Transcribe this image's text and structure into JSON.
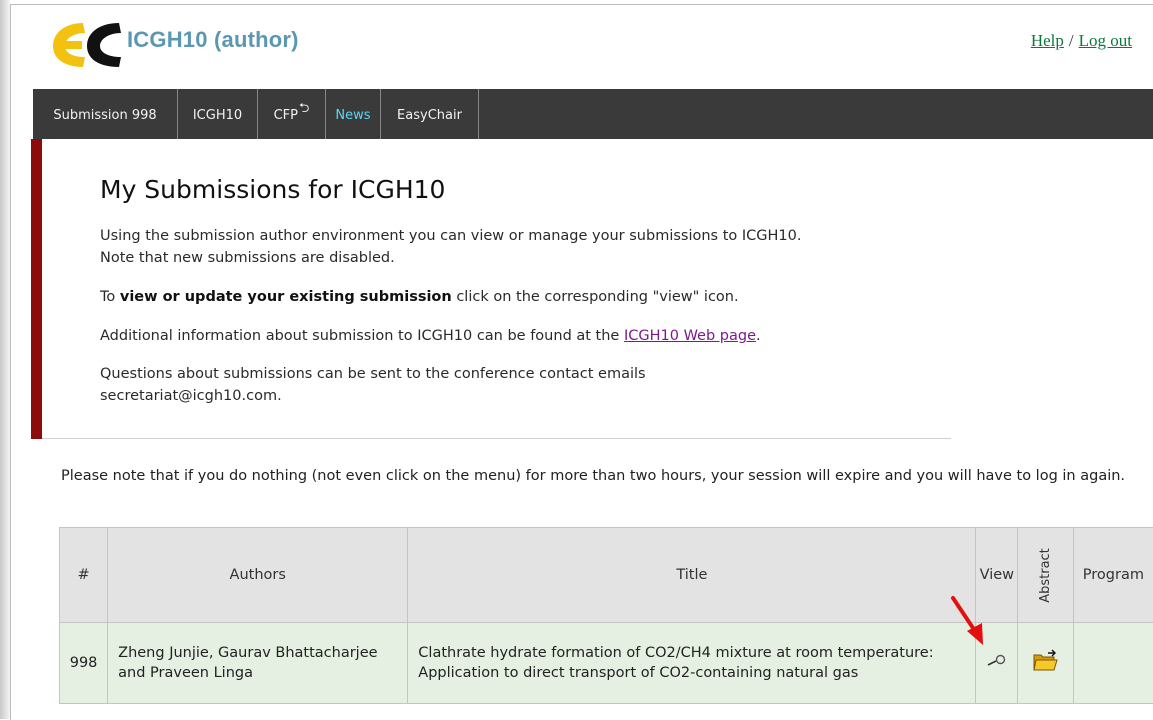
{
  "header": {
    "app_title": "ICGH10 (author)",
    "help_link": "Help",
    "separator": "/",
    "logout_link": "Log out"
  },
  "menu": {
    "items": [
      {
        "label": "Submission 998"
      },
      {
        "label": "ICGH10"
      },
      {
        "label": "CFP"
      },
      {
        "label": "News"
      },
      {
        "label": "EasyChair"
      }
    ]
  },
  "main": {
    "title": "My Submissions for ICGH10",
    "p1_line1": "Using the submission author environment you can view or manage your submissions to ICGH10.",
    "p1_line2": "Note that new submissions are disabled.",
    "p2_prefix": "To ",
    "p2_bold": "view or update your existing submission",
    "p2_suffix": " click on the corresponding \"view\" icon.",
    "p3_prefix": "Additional information about submission to ICGH10 can be found at the ",
    "p3_link": "ICGH10 Web page",
    "p3_suffix": ".",
    "p4_line1": "Questions about submissions can be sent to the conference contact emails",
    "p4_line2": "secretariat@icgh10.com."
  },
  "session_note": "Please note that if you do nothing (not even click on the menu) for more than two hours, your session will expire and you will have to log in again.",
  "table": {
    "headers": {
      "num": "#",
      "authors": "Authors",
      "title": "Title",
      "view": "View",
      "abstract": "Abstract",
      "program": "Program"
    },
    "rows": [
      {
        "num": "998",
        "authors": "Zheng Junjie, Gaurav Bhattacharjee and Praveen Linga",
        "title": "Clathrate hydrate formation of CO2/CH4 mixture at room temperature: Application to direct transport of CO2-containing natural gas",
        "view_icon": "magnifier-icon",
        "abstract_icon": "open-folder-icon",
        "program": ""
      }
    ]
  },
  "colors": {
    "title_blue": "#5c97b2",
    "menu_bg": "#3a3a3a",
    "menu_active": "#58d8f2",
    "accent_red": "#8c0c0c",
    "link_green": "#0a7a3c",
    "link_purple": "#7a1b8c",
    "row_green": "#e6f0e2",
    "arrow_red": "#e31010"
  }
}
